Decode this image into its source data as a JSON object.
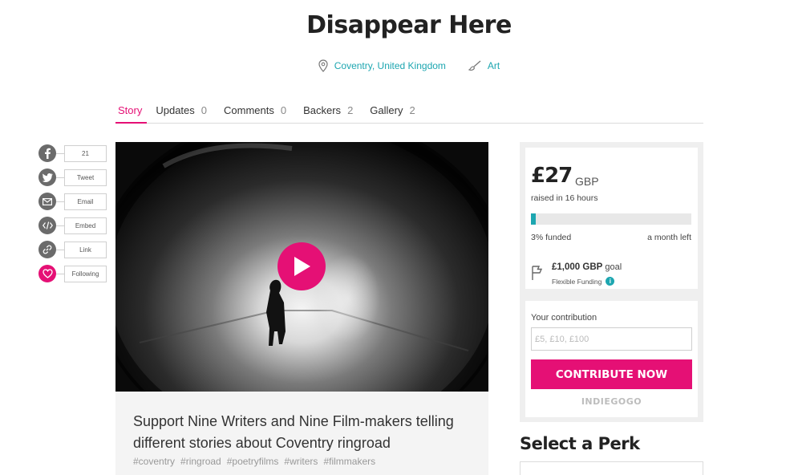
{
  "campaign": {
    "title": "Disappear Here",
    "location": "Coventry, United Kingdom",
    "category": "Art"
  },
  "tabs": [
    {
      "label": "Story",
      "count": ""
    },
    {
      "label": "Updates",
      "count": "0"
    },
    {
      "label": "Comments",
      "count": "0"
    },
    {
      "label": "Backers",
      "count": "2"
    },
    {
      "label": "Gallery",
      "count": "2"
    }
  ],
  "share": [
    {
      "label": "21",
      "icon": "facebook-icon"
    },
    {
      "label": "Tweet",
      "icon": "twitter-icon"
    },
    {
      "label": "Email",
      "icon": "email-icon"
    },
    {
      "label": "Embed",
      "icon": "embed-icon"
    },
    {
      "label": "Link",
      "icon": "link-icon"
    },
    {
      "label": "Following",
      "icon": "heart-icon"
    }
  ],
  "video": {
    "caption": "Support Nine Writers and Nine Film-makers telling different stories about Coventry ringroad",
    "tags": [
      "#coventry",
      "#ringroad",
      "#poetryfilms",
      "#writers",
      "#filmmakers"
    ]
  },
  "funding": {
    "amount": "£27",
    "currency": "GBP",
    "raised": "raised in 16 hours",
    "funded_fraction": 0.03,
    "funded_label": "3% funded",
    "time_left": "a month left",
    "goal_amount": "£1,000 GBP",
    "goal_suffix": "goal",
    "funding_type": "Flexible Funding"
  },
  "contribute": {
    "label": "Your contribution",
    "placeholder": "£5, £10, £100",
    "button": "CONTRIBUTE NOW",
    "brand": "INDIEGOGO"
  },
  "perks": {
    "title": "Select a Perk"
  },
  "colors": {
    "accent": "#e51075",
    "teal": "#1da6b0"
  }
}
